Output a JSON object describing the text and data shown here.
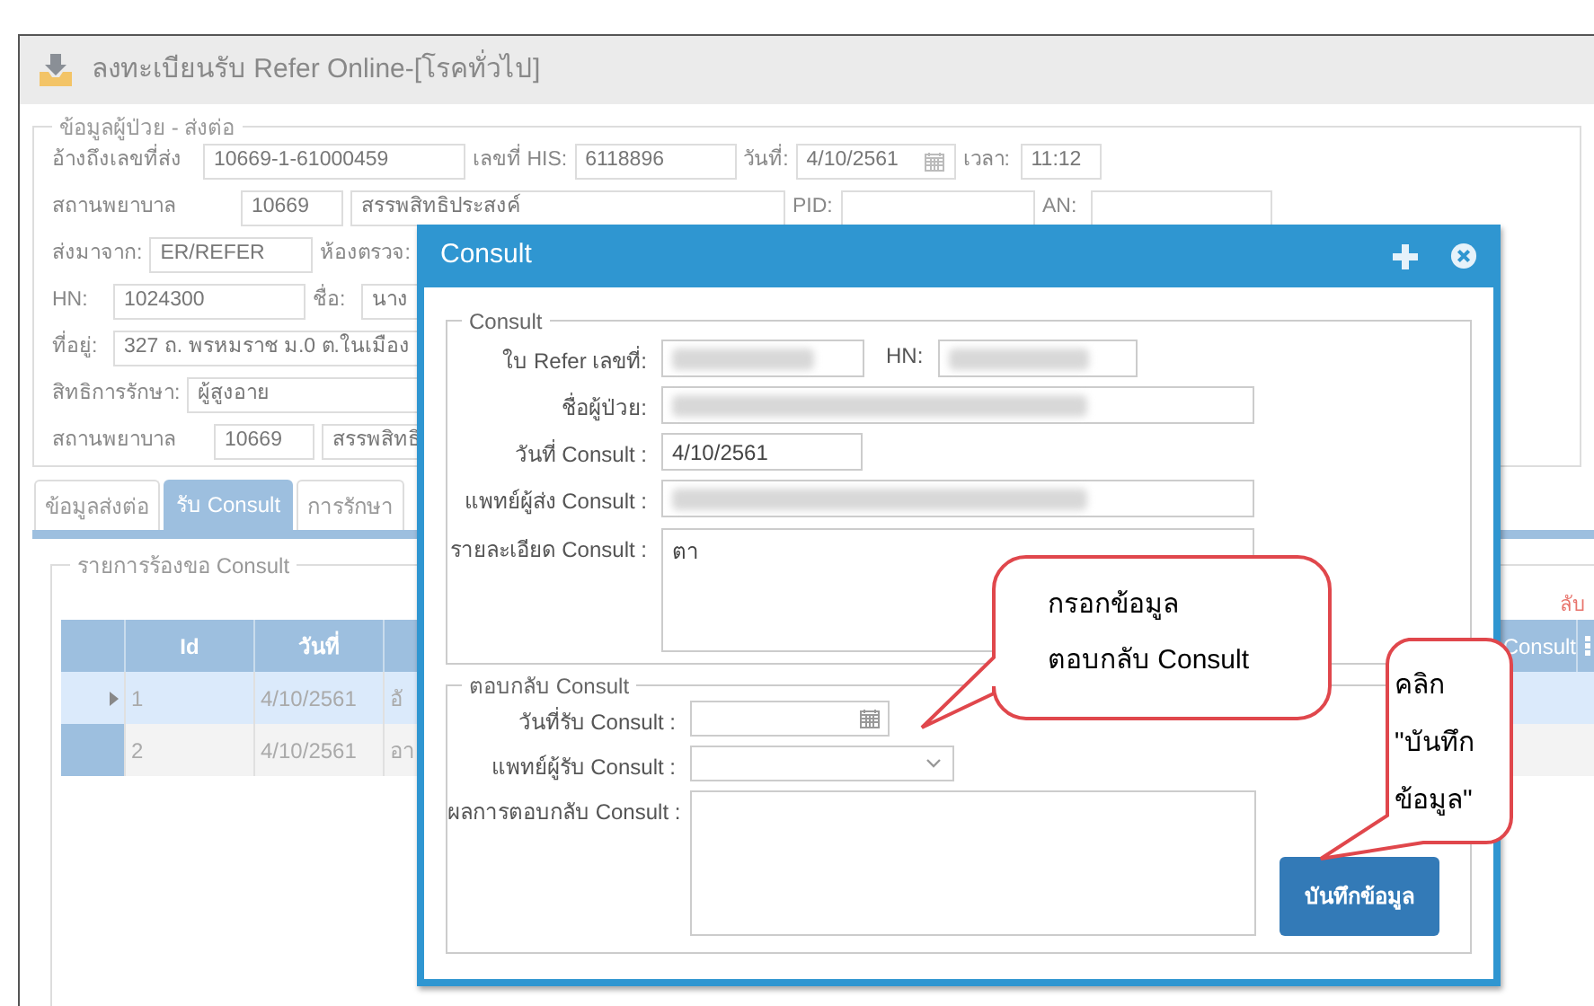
{
  "app_title": "ลงทะเบียนรับ Refer Online-[โรคทั่วไป]",
  "patient_group": {
    "legend": "ข้อมูลผู้ป่วย - ส่งต่อ",
    "lines": [
      {
        "fields": [
          {
            "label": "อ้างถึงเลขที่ส่ง",
            "kind": "text",
            "values": [
              "10669-1-61000459"
            ]
          },
          {
            "label": "เลขที่ HIS:",
            "kind": "text",
            "values": [
              "6118896"
            ]
          },
          {
            "label": "วันที่:",
            "kind": "date",
            "values": [
              "4/10/2561"
            ]
          },
          {
            "label": "เวลา:",
            "kind": "text",
            "values": [
              "11:12"
            ]
          }
        ]
      },
      {
        "fields": [
          {
            "label": "สถานพยาบาล",
            "kind": "text",
            "values": [
              "10669",
              "สรรพสิทธิประสงค์"
            ]
          },
          {
            "label": "PID:",
            "kind": "text"
          },
          {
            "label": "AN:",
            "kind": "text"
          }
        ]
      },
      {
        "fields": [
          {
            "label": "ส่งมาจาก:",
            "kind": "text",
            "values": [
              "ER/REFER"
            ]
          },
          {
            "label": "ห้องตรวจ:",
            "kind": "text"
          }
        ]
      },
      {
        "fields": [
          {
            "label": "HN:",
            "kind": "text",
            "values": [
              "1024300"
            ]
          },
          {
            "label": "ชื่อ:",
            "kind": "text",
            "values": [
              "นาง"
            ]
          }
        ]
      },
      {
        "fields": [
          {
            "label": "ที่อยู่:",
            "kind": "text",
            "values": [
              "327  ถ. พรหมราช ม.0 ต.ในเมือง"
            ]
          }
        ]
      },
      {
        "fields": [
          {
            "label": "สิทธิการรักษา:",
            "kind": "text",
            "values": [
              "ผู้สูงอาย"
            ]
          }
        ]
      },
      {
        "fields": [
          {
            "label": "สถานพยาบาล",
            "kind": "text",
            "values": [
              "10669",
              "สรรพสิทธิ"
            ]
          }
        ]
      }
    ]
  },
  "tabs": [
    {
      "label": "ข้อมูลส่งต่อ",
      "selected": false
    },
    {
      "label": "รับ Consult",
      "selected": true
    },
    {
      "label": "การรักษา",
      "selected": false
    }
  ],
  "request_group": {
    "legend": "รายการร้องขอ Consult",
    "note": "ลับ",
    "columns": [
      "Id",
      "วันที่",
      "",
      "Consult"
    ],
    "rows": [
      {
        "selected": true,
        "cells": [
          "1",
          "4/10/2561",
          "อั"
        ]
      },
      {
        "selected": false,
        "cells": [
          "2",
          "4/10/2561",
          "อา"
        ]
      }
    ]
  },
  "dialog": {
    "title": "Consult",
    "consult_group": {
      "legend": "Consult",
      "refer_no": {
        "label": "ใบ Refer เลขที่:",
        "blurred": true
      },
      "hn": {
        "label": "HN:",
        "blurred": true
      },
      "patient_name": {
        "label": "ชื่อผู้ป่วย:",
        "blurred": true
      },
      "consult_date": {
        "label": "วันที่ Consult :",
        "value": "4/10/2561"
      },
      "sender_doctor": {
        "label": "แพทย์ผู้ส่ง Consult :",
        "blurred": true
      },
      "details": {
        "label": "รายละเอียด Consult :",
        "value": "ตา"
      }
    },
    "reply_group": {
      "legend": "ตอบกลับ Consult",
      "received_date": {
        "label": "วันที่รับ Consult :"
      },
      "receiver_doctor": {
        "label": "แพทย์ผู้รับ Consult :"
      },
      "result": {
        "label": "ผลการตอบกลับ Consult :"
      }
    },
    "save_button": "บันทึกข้อมูล"
  },
  "callouts": [
    {
      "text": "กรอกข้อมูล\nตอบกลับ Consult"
    },
    {
      "text": "คลิก\n\"บันทึก\nข้อมูล\""
    }
  ]
}
